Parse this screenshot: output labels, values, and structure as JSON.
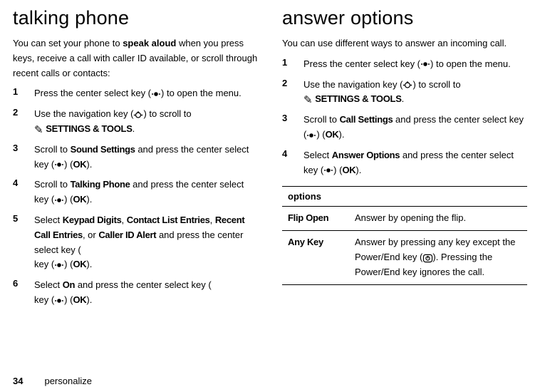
{
  "left": {
    "heading": "talking phone",
    "intro_a": "You can set your phone to ",
    "intro_bold": "speak aloud",
    "intro_b": " when you press keys, receive a call with caller ID available, or scroll through recent calls or contacts:",
    "steps": {
      "s1a": "Press the center select key (",
      "s1b": ") to open the menu.",
      "s2a": "Use the navigation key (",
      "s2b": ") to scroll to ",
      "s2c": "SETTINGS & TOOLS",
      "s2d": ".",
      "s3a": "Scroll to ",
      "s3b": "Sound Settings",
      "s3c": " and press the center select key (",
      "s3d": ") (",
      "s3e": "OK",
      "s3f": ").",
      "s4a": "Scroll to ",
      "s4b": "Talking Phone",
      "s4c": " and press the center select key (",
      "s4d": ") (",
      "s4e": "OK",
      "s4f": ").",
      "s5a": "Select ",
      "s5b": "Keypad Digits",
      "s5c": ", ",
      "s5d": "Contact List Entries",
      "s5e": ", ",
      "s5f": "Recent Call Entries",
      "s5g": ", or ",
      "s5h": "Caller ID Alert",
      "s5i": " and press the center select key (",
      "s5j": ") (",
      "s5k": "OK",
      "s5l": ").",
      "s6a": "Select ",
      "s6b": "On",
      "s6c": " and press the center select key (",
      "s6d": ") (",
      "s6e": "OK",
      "s6f": ")."
    }
  },
  "right": {
    "heading": "answer options",
    "intro": "You can use different ways to answer an incoming call.",
    "steps": {
      "s1a": "Press the center select key (",
      "s1b": ") to open the menu.",
      "s2a": "Use the navigation key (",
      "s2b": ") to scroll to ",
      "s2c": "SETTINGS & TOOLS",
      "s2d": ".",
      "s3a": "Scroll to ",
      "s3b": "Call Settings",
      "s3c": " and press the center select key (",
      "s3d": ") (",
      "s3e": "OK",
      "s3f": ").",
      "s4a": "Select ",
      "s4b": "Answer Options",
      "s4c": " and press the center select key (",
      "s4d": ") (",
      "s4e": "OK",
      "s4f": ")."
    },
    "table": {
      "header": "options",
      "rows": [
        {
          "name": "Flip Open",
          "desc_a": "Answer by opening the flip."
        },
        {
          "name": "Any Key",
          "desc_a": "Answer by pressing any key except the Power/End key (",
          "desc_b": "). Pressing the Power/End key ignores the call."
        }
      ]
    }
  },
  "footer": {
    "page": "34",
    "section": "personalize"
  },
  "nums": {
    "n1": "1",
    "n2": "2",
    "n3": "3",
    "n4": "4",
    "n5": "5",
    "n6": "6"
  }
}
